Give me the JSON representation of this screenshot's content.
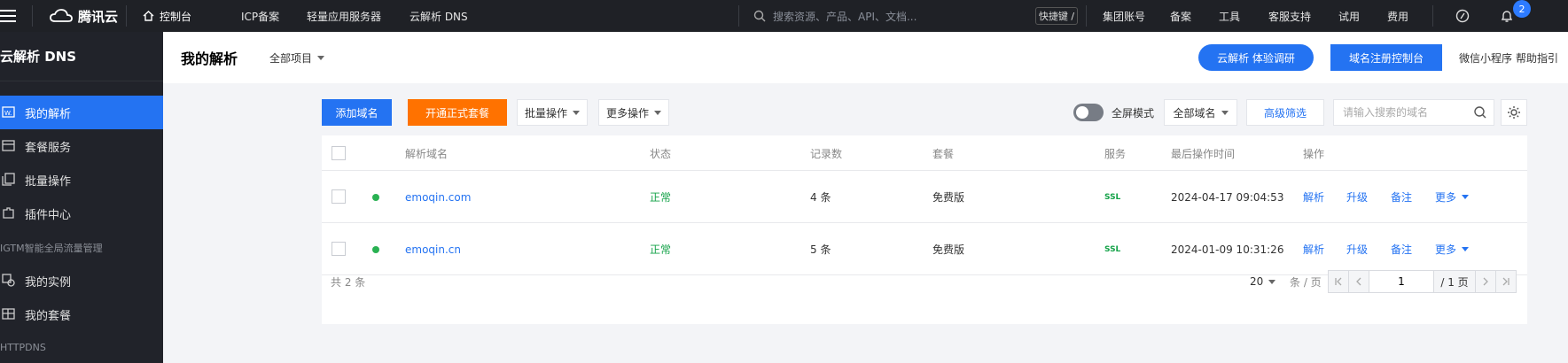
{
  "topbar": {
    "brand": "腾讯云",
    "console": "控制台",
    "nav": [
      "ICP备案",
      "轻量应用服务器",
      "云解析 DNS"
    ],
    "search_placeholder": "搜索资源、产品、API、文档...",
    "shortcut": "快捷键 /",
    "right_links": [
      "集团账号",
      "备案",
      "工具",
      "客服支持",
      "试用",
      "费用"
    ],
    "notification_count": "2"
  },
  "sidebar": {
    "title": "云解析 DNS",
    "items": [
      {
        "label": "我的解析",
        "icon": "domain-list-icon",
        "active": true
      },
      {
        "label": "套餐服务",
        "icon": "package-icon",
        "active": false
      },
      {
        "label": "批量操作",
        "icon": "batch-icon",
        "active": false
      },
      {
        "label": "插件中心",
        "icon": "plugin-icon",
        "active": false
      }
    ],
    "group_gtm": "IGTM智能全局流量管理",
    "gtm_items": [
      {
        "label": "我的实例",
        "icon": "instance-icon"
      },
      {
        "label": "我的套餐",
        "icon": "plan-icon"
      }
    ],
    "group_httpdns": "HTTPDNS"
  },
  "header": {
    "title": "我的解析",
    "project_select": "全部项目",
    "survey_button": "云解析 体验调研",
    "registrar_button": "域名注册控制台",
    "links": [
      "微信小程序",
      "帮助指引"
    ]
  },
  "toolbar": {
    "add_domain": "添加域名",
    "open_plan": "开通正式套餐",
    "batch_ops": "批量操作",
    "more_ops": "更多操作",
    "fullscreen": "全屏模式",
    "domain_filter": "全部域名",
    "advanced_filter": "高级筛选",
    "search_placeholder": "请输入搜索的域名"
  },
  "table": {
    "columns": [
      "解析域名",
      "状态",
      "记录数",
      "套餐",
      "服务",
      "最后操作时间",
      "操作"
    ],
    "rows": [
      {
        "domain": "emoqin.com",
        "status": "正常",
        "records": "4 条",
        "plan": "免费版",
        "service": "SSL",
        "time": "2024-04-17 09:04:53",
        "actions": [
          "解析",
          "升级",
          "备注",
          "更多"
        ]
      },
      {
        "domain": "emoqin.cn",
        "status": "正常",
        "records": "5 条",
        "plan": "免费版",
        "service": "SSL",
        "time": "2024-01-09 10:31:26",
        "actions": [
          "解析",
          "升级",
          "备注",
          "更多"
        ]
      }
    ],
    "total": "共 2 条",
    "page_size": "20",
    "per_page_label": "条 / 页",
    "current_page": "1",
    "total_pages": "/ 1 页"
  },
  "colors": {
    "primary": "#2473f2",
    "orange": "#ff7200",
    "success": "#16a34a",
    "sidebar_bg": "#21232a",
    "topbar_bg": "#1f2126"
  }
}
